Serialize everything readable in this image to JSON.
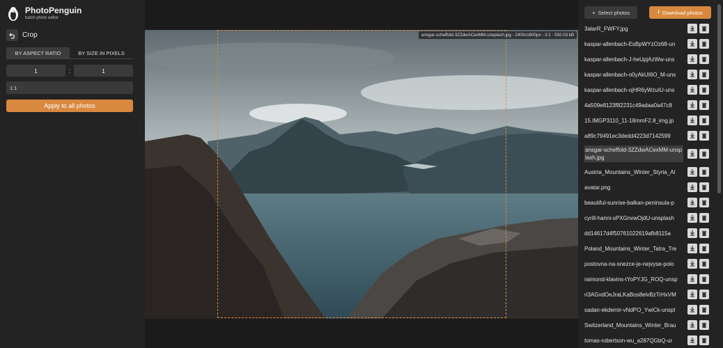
{
  "app": {
    "name": "PhotoPenguin",
    "tagline": "batch photo editor"
  },
  "crop": {
    "title": "Crop",
    "tabs": [
      "BY ASPECT RATIO",
      "BY SIZE IN PIXELS"
    ],
    "active_tab": 0,
    "ratio_w": "1",
    "ratio_h": "1",
    "separator": ":",
    "preset": "1:1",
    "apply_label": "Apply to all photos"
  },
  "viewer": {
    "info": "ansgar-scheffold-3ZZdwACexMM-unsplash.jpg - 2400x1600px - 3:2 - 592.03 kB",
    "crop_fraction_left": 0.167,
    "crop_fraction_width": 0.667
  },
  "toolbar": {
    "select_label": "Select photos",
    "download_label": "Download photos"
  },
  "colors": {
    "accent": "#d8893f",
    "panel": "#232323",
    "background": "#1b1b1b"
  },
  "files": [
    "3alarR_FWFY.jpg",
    "kaspar-allenbach-EsBpWYzOz68-un",
    "kaspar-allenbach-J-heUpjAzWw-uns",
    "kaspar-allenbach-o0yAkUI6O_M-uns",
    "kaspar-allenbach-ojHR6yWzuIU-uns",
    "4a509e8123f82231c49adaa0a47c8",
    "15.IMGP3110_11-18mmF2.8_img.jp",
    "a89c79491ec3dedd4223d7142599",
    "ansgar-scheffold-3ZZdwACexMM-unsplash.jpg",
    "Austria_Mountains_Winter_Styria_Al",
    "avatar.png",
    "beautiful-sunrise-balkan-peninsula-p",
    "cyrill-hanni-sPXGnvwOjdU-unsplash",
    "dd14617d4f50761022619afb8115a",
    "Poland_Mountains_Winter_Tatra_Tre",
    "postovna-na-snezce-je-nejvyse-polo",
    "raimond-klavins-tYoPYJG_ROQ-unsp",
    "ri3AGvdOeJraLKaBos8elvBzTrHxVM",
    "sadan-ekdemir-vNdPO_YwiCk-unspl",
    "Switzerland_Mountains_Winter_Brau",
    "tomas-robertson-wu_a287QGbQ-ur"
  ],
  "selected_file_index": 8,
  "icons": {
    "download": "download-icon",
    "delete": "trash-icon",
    "back": "undo-arrow-icon",
    "add": "plus-icon"
  }
}
